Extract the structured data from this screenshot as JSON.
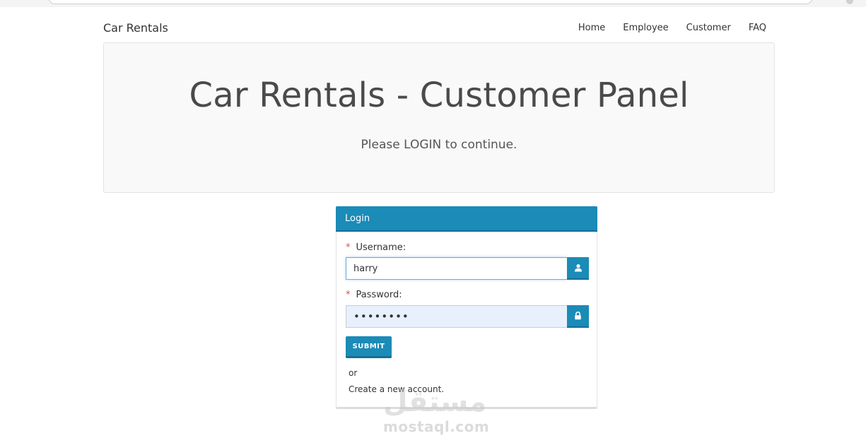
{
  "navbar": {
    "brand": "Car Rentals",
    "links": [
      "Home",
      "Employee",
      "Customer",
      "FAQ"
    ]
  },
  "jumbotron": {
    "title": "Car Rentals - Customer Panel",
    "subtitle": "Please LOGIN to continue."
  },
  "login": {
    "title": "Login",
    "required_mark": "*",
    "username_label": "Username:",
    "username_value": "harry",
    "username_icon": "user-icon",
    "password_label": "Password:",
    "password_value": "••••••••",
    "password_icon": "lock-icon",
    "submit_label": "SUBMIT",
    "or_text": "or",
    "create_account_text": "Create a new account."
  },
  "watermark": {
    "arabic": "مستقل",
    "latin": "mostaql.com"
  },
  "colors": {
    "primary": "#1b8bb7",
    "primary_dark": "#156f93",
    "required": "#d9534f",
    "jumbotron_bg": "#f9f9f9",
    "password_bg": "#e8f0fe"
  }
}
